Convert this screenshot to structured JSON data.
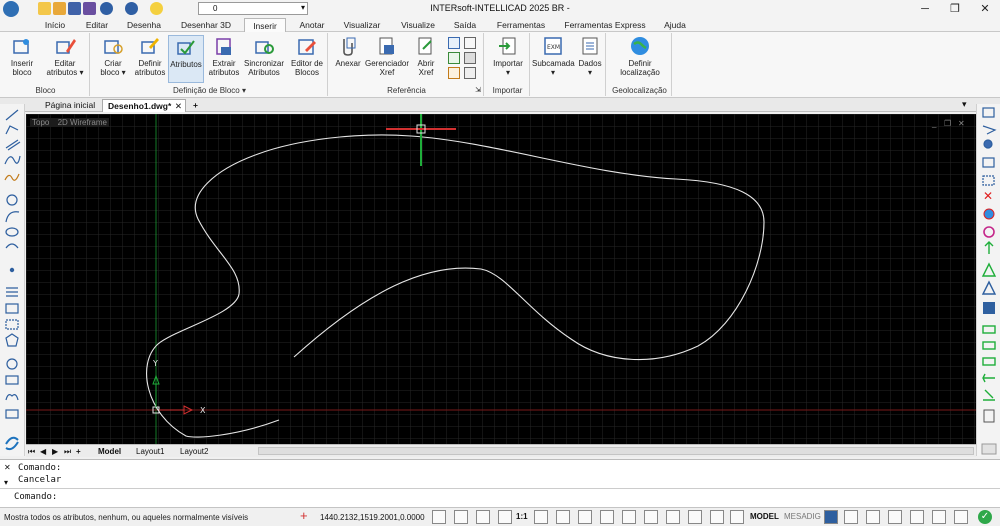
{
  "window": {
    "title": "INTERsoft-INTELLICAD 2025 BR -"
  },
  "quick_access": {
    "layer_value": "0"
  },
  "menu_tabs": [
    "Início",
    "Editar",
    "Desenha",
    "Desenhar 3D",
    "Inserir",
    "Anotar",
    "Visualizar",
    "Visualize",
    "Saída",
    "Ferramentas",
    "Ferramentas Express",
    "Ajuda"
  ],
  "active_tab": "Inserir",
  "ribbon": {
    "groups": [
      {
        "label": "Bloco",
        "buttons": [
          "Inserir bloco",
          "Editar atributos"
        ]
      },
      {
        "label": "Definição de Bloco",
        "buttons": [
          "Criar bloco",
          "Definir atributos",
          "Atributos",
          "Extrair atributos",
          "Sincronizar Atributos",
          "Editor de Blocos"
        ]
      },
      {
        "label": "Referência",
        "buttons": [
          "Anexar",
          "Gerenciador Xref",
          "Abrir Xref"
        ]
      },
      {
        "label": "Importar",
        "buttons": [
          "Importar"
        ]
      },
      {
        "label": "",
        "buttons": [
          "Subcamada",
          "Dados"
        ]
      },
      {
        "label": "Geolocalização",
        "buttons": [
          "Definir localização"
        ]
      }
    ]
  },
  "doc_tabs": [
    "Página inicial",
    "Desenho1.dwg*"
  ],
  "viewport": {
    "view": "Topo",
    "style": "2D Wireframe"
  },
  "axes": {
    "x": "X",
    "y": "Y"
  },
  "layout_tabs": [
    "Model",
    "Layout1",
    "Layout2"
  ],
  "command": {
    "history": [
      "Comando:",
      "Cancelar"
    ],
    "prompt": "Comando:"
  },
  "status": {
    "message": "Mostra todos os atributos, nenhum, ou aqueles normalmente visíveis",
    "coords": "1440.2132,1519.2001,0.0000",
    "scale": "1:1",
    "model_label": "MODEL",
    "mesadig_label": "MESADIG"
  },
  "colors": {
    "canvas_bg": "#000000",
    "grid": "#2a2a2a",
    "curve": "#e6e6e6",
    "cursor": "#d23030",
    "y_axis": "#1fae3a"
  }
}
